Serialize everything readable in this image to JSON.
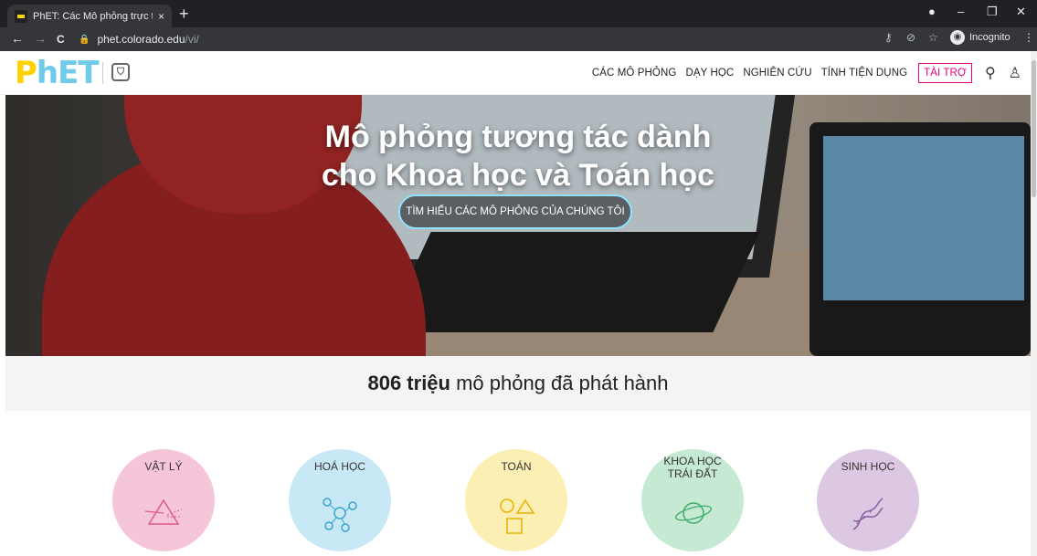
{
  "browser": {
    "tab_title": "PhET: Các Mô phỏng trực tuyến, ",
    "tab_close": "×",
    "new_tab": "+",
    "url_domain": "phet.colorado.edu",
    "url_path": "/vi/",
    "incognito_label": "Incognito",
    "win_minimize": "–",
    "win_maximize": "❐",
    "win_close": "✕",
    "nav_back": "←",
    "nav_forward": "→",
    "nav_reload": "C"
  },
  "site": {
    "logo_p": "P",
    "logo_h": "h",
    "logo_et": "ET",
    "nav": {
      "simulations": "CÁC MÔ PHỎNG",
      "teaching": "DẠY HỌC",
      "research": "NGHIÊN CỨU",
      "accessibility": "TÍNH TIỆN DỤNG",
      "donate": "TÀI TRỢ"
    }
  },
  "hero": {
    "title_line1": "Mô phỏng tương tác dành",
    "title_line2": "cho Khoa học và Toán học",
    "cta": "TÌM HIỂU CÁC MÔ PHỎNG CỦA CHÚNG TÔI"
  },
  "stats": {
    "count": "806 triệu",
    "text": " mô phỏng đã phát hành"
  },
  "categories": [
    {
      "line1": "VẬT LÝ",
      "line2": "",
      "color": "#f5c6d9"
    },
    {
      "line1": "HOÁ HỌC",
      "line2": "",
      "color": "#c9e8f5"
    },
    {
      "line1": "TOÁN",
      "line2": "",
      "color": "#fcefb4"
    },
    {
      "line1": "KHOA HỌC",
      "line2": "TRÁI ĐẤT",
      "color": "#c6e9d3"
    },
    {
      "line1": "SINH HỌC",
      "line2": "",
      "color": "#dcc8e2"
    }
  ]
}
